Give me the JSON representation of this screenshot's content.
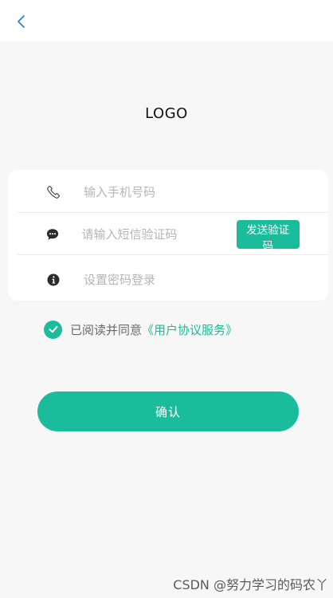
{
  "header": {
    "back_icon": "chevron-left-icon"
  },
  "logo": {
    "text": "LOGO"
  },
  "form": {
    "phone": {
      "icon": "phone-icon",
      "placeholder": "输入手机号码",
      "value": ""
    },
    "sms_code": {
      "icon": "chat-bubble-icon",
      "placeholder": "请输入短信验证码",
      "value": "",
      "send_button_label": "发送验证码"
    },
    "password": {
      "icon": "info-icon",
      "placeholder": "设置密码登录",
      "value": ""
    }
  },
  "agreement": {
    "checked": true,
    "text": "已阅读并同意",
    "link_text": "《用户协议服务》"
  },
  "confirm_button": {
    "label": "确认"
  },
  "watermark": {
    "text": "CSDN @努力学习的码农丫"
  },
  "colors": {
    "accent": "#1abc9c",
    "back_arrow": "#3b7bd6",
    "background": "#f7f7f7"
  }
}
